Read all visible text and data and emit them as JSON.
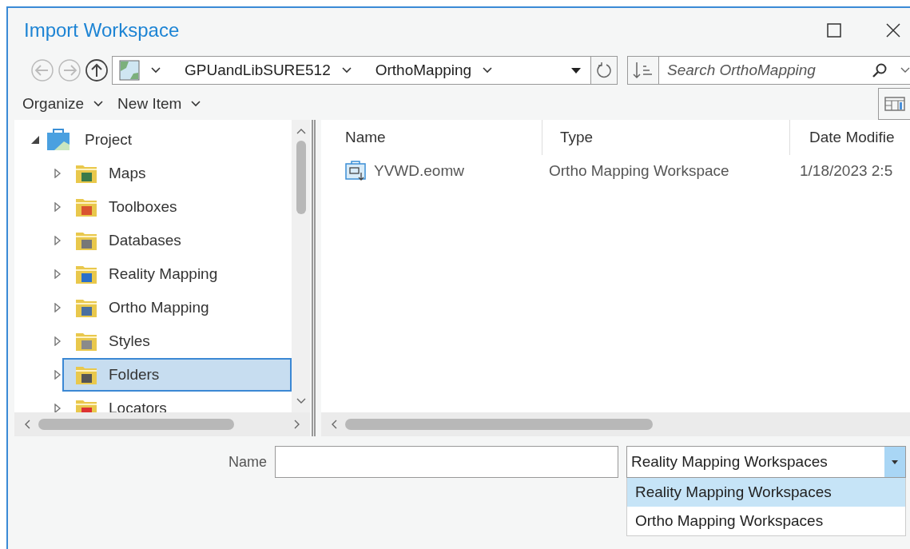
{
  "window": {
    "title": "Import Workspace"
  },
  "address": {
    "crumbs": [
      "GPUandLibSURE512",
      "OrthoMapping"
    ]
  },
  "search": {
    "placeholder": "Search OrthoMapping"
  },
  "toolbar": [
    "Organize",
    "New Item"
  ],
  "tree": [
    {
      "label": "Project",
      "kind": "project",
      "expanded": true,
      "selected": false,
      "children": [
        {
          "label": "Maps",
          "kind": "maps",
          "expanded": false,
          "selected": false
        },
        {
          "label": "Toolboxes",
          "kind": "toolboxes",
          "expanded": false,
          "selected": false
        },
        {
          "label": "Databases",
          "kind": "databases",
          "expanded": false,
          "selected": false
        },
        {
          "label": "Reality Mapping",
          "kind": "reality",
          "expanded": false,
          "selected": false
        },
        {
          "label": "Ortho Mapping",
          "kind": "ortho",
          "expanded": false,
          "selected": false
        },
        {
          "label": "Styles",
          "kind": "styles",
          "expanded": false,
          "selected": false
        },
        {
          "label": "Folders",
          "kind": "folders",
          "expanded": false,
          "selected": true
        },
        {
          "label": "Locators",
          "kind": "locators",
          "expanded": false,
          "selected": false
        }
      ]
    }
  ],
  "columns": [
    "Name",
    "Type",
    "Date Modifie"
  ],
  "rows": [
    {
      "cells": [
        "YVWD.eomw",
        "Ortho Mapping Workspace",
        "1/18/2023 2:5"
      ]
    }
  ],
  "name_field": {
    "label": "Name"
  },
  "file_type": {
    "value": "Reality Mapping Workspaces",
    "options": [
      {
        "label": "Reality Mapping Workspaces",
        "selected": true
      },
      {
        "label": "Ortho Mapping Workspaces",
        "selected": false
      }
    ]
  }
}
